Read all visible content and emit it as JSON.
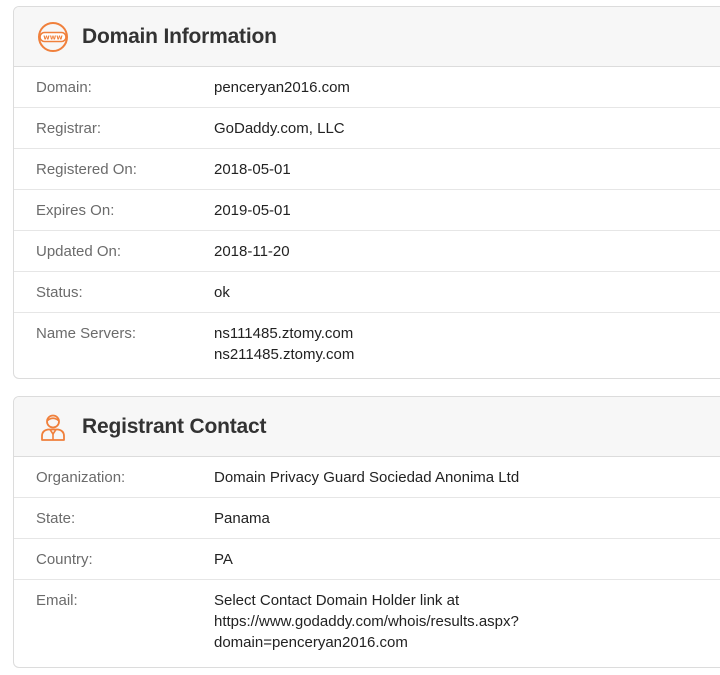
{
  "domain_info": {
    "title": "Domain Information",
    "icon": "www-icon",
    "rows": [
      {
        "label": "Domain:",
        "value": "penceryan2016.com"
      },
      {
        "label": "Registrar:",
        "value": "GoDaddy.com, LLC"
      },
      {
        "label": "Registered On:",
        "value": "2018-05-01"
      },
      {
        "label": "Expires On:",
        "value": "2019-05-01"
      },
      {
        "label": "Updated On:",
        "value": "2018-11-20"
      },
      {
        "label": "Status:",
        "value": "ok"
      },
      {
        "label": "Name Servers:",
        "values": [
          "ns111485.ztomy.com",
          "ns211485.ztomy.com"
        ]
      }
    ]
  },
  "registrant": {
    "title": "Registrant Contact",
    "icon": "person-icon",
    "rows": [
      {
        "label": "Organization:",
        "value": "Domain Privacy Guard Sociedad Anonima Ltd"
      },
      {
        "label": "State:",
        "value": "Panama"
      },
      {
        "label": "Country:",
        "value": "PA"
      },
      {
        "label": "Email:",
        "values": [
          "Select Contact Domain Holder link at",
          "https://www.godaddy.com/whois/results.aspx?",
          "domain=penceryan2016.com"
        ]
      }
    ]
  },
  "colors": {
    "accent": "#f0803c",
    "header_bg": "#f7f7f7",
    "border": "#dcdcdc"
  }
}
